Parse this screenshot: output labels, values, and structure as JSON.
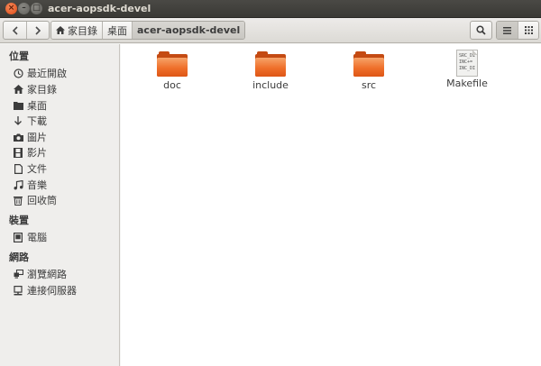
{
  "window": {
    "title": "acer-aopsdk-devel"
  },
  "toolbar": {
    "breadcrumbs": [
      {
        "label": "家目錄",
        "icon": "home-icon"
      },
      {
        "label": "桌面"
      },
      {
        "label": "acer-aopsdk-devel",
        "active": true
      }
    ]
  },
  "sidebar": {
    "sections": [
      {
        "title": "位置",
        "items": [
          {
            "label": "最近開啟",
            "icon": "clock-icon"
          },
          {
            "label": "家目錄",
            "icon": "home-icon"
          },
          {
            "label": "桌面",
            "icon": "desktop-icon"
          },
          {
            "label": "下載",
            "icon": "download-icon"
          },
          {
            "label": "圖片",
            "icon": "camera-icon"
          },
          {
            "label": "影片",
            "icon": "film-icon"
          },
          {
            "label": "文件",
            "icon": "document-icon"
          },
          {
            "label": "音樂",
            "icon": "music-icon"
          },
          {
            "label": "回收筒",
            "icon": "trash-icon"
          }
        ]
      },
      {
        "title": "裝置",
        "items": [
          {
            "label": "電腦",
            "icon": "computer-icon"
          }
        ]
      },
      {
        "title": "網路",
        "items": [
          {
            "label": "瀏覽網路",
            "icon": "network-icon"
          },
          {
            "label": "連接伺服器",
            "icon": "server-icon"
          }
        ]
      }
    ]
  },
  "files": [
    {
      "name": "doc",
      "type": "folder"
    },
    {
      "name": "include",
      "type": "folder"
    },
    {
      "name": "src",
      "type": "folder"
    },
    {
      "name": "Makefile",
      "type": "text",
      "preview": [
        "SRC_DI",
        "INC+=",
        "INC_DI"
      ]
    }
  ]
}
